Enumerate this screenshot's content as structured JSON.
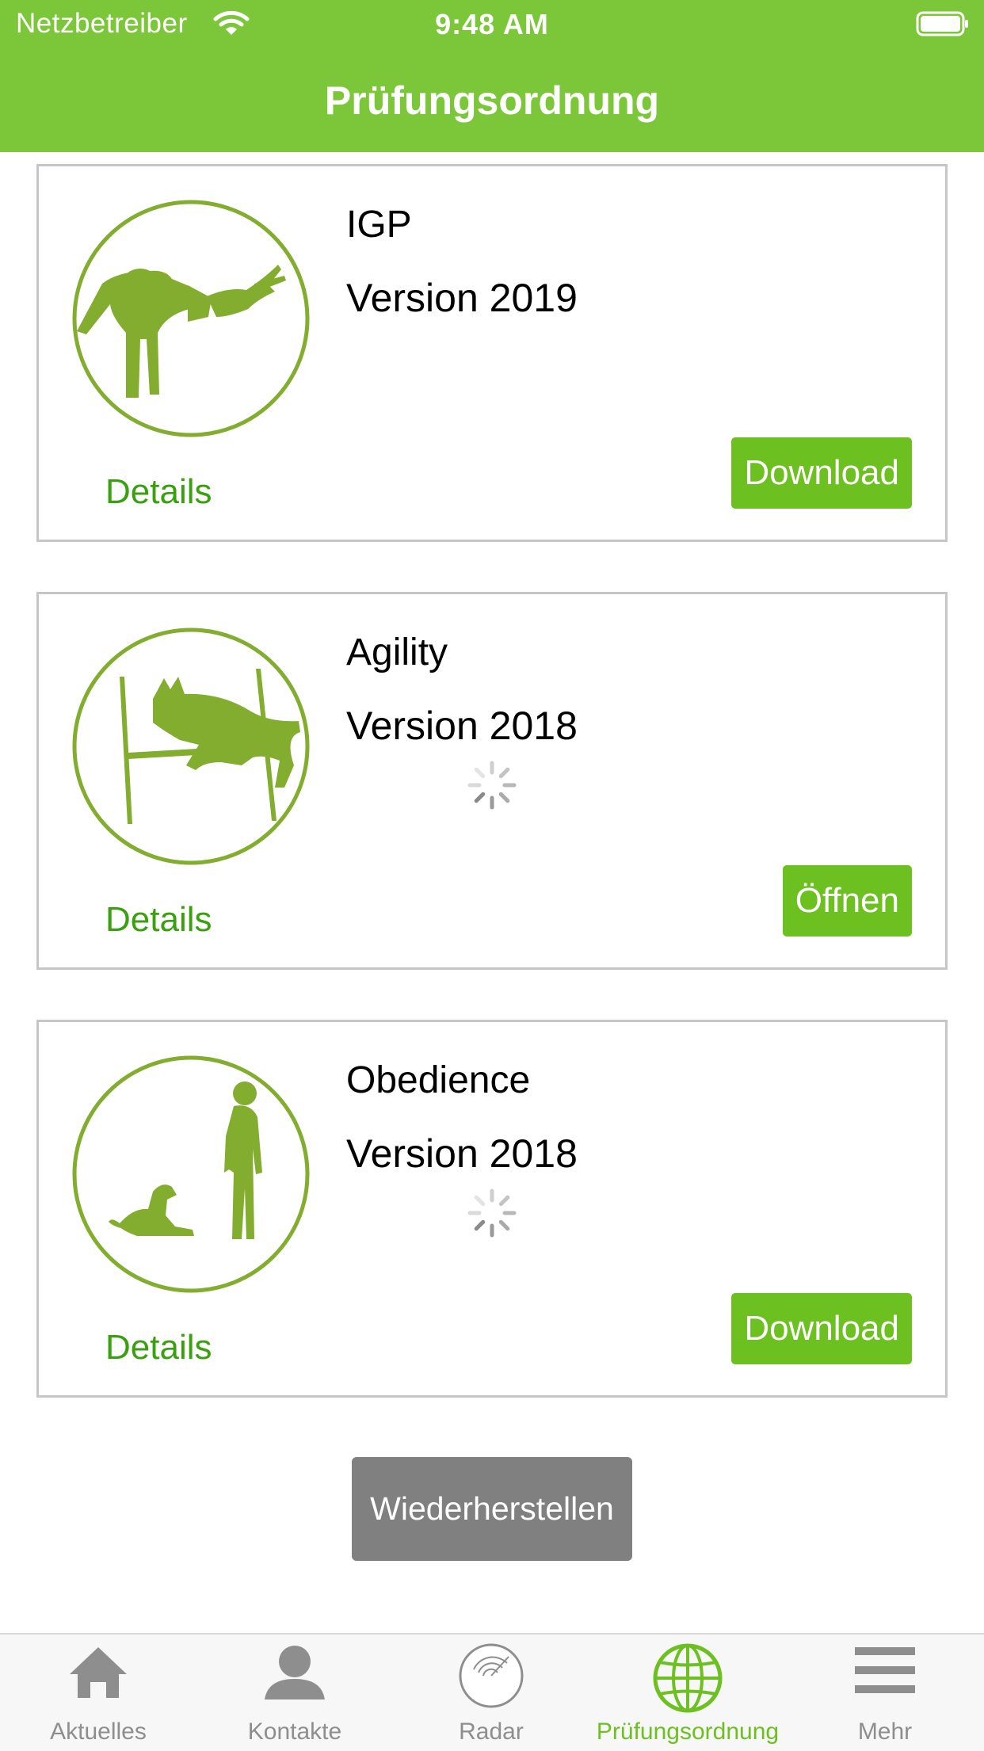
{
  "status_bar": {
    "carrier": "Netzbetreiber",
    "time": "9:48 AM"
  },
  "nav": {
    "title": "Prüfungsordnung"
  },
  "cards": [
    {
      "title": "IGP",
      "version": "Version 2019",
      "details_label": "Details",
      "action_label": "Download",
      "icon": "igp-bitework-icon",
      "loading": false
    },
    {
      "title": "Agility",
      "version": "Version 2018",
      "details_label": "Details",
      "action_label": "Öffnen",
      "icon": "agility-jump-icon",
      "loading": true
    },
    {
      "title": "Obedience",
      "version": "Version 2018",
      "details_label": "Details",
      "action_label": "Download",
      "icon": "obedience-icon",
      "loading": true
    }
  ],
  "restore_label": "Wiederherstellen",
  "tabs": [
    {
      "label": "Aktuelles",
      "icon": "home-icon",
      "active": false
    },
    {
      "label": "Kontakte",
      "icon": "person-icon",
      "active": false
    },
    {
      "label": "Radar",
      "icon": "radar-icon",
      "active": false
    },
    {
      "label": "Prüfungsordnung",
      "icon": "globe-icon",
      "active": true
    },
    {
      "label": "Mehr",
      "icon": "menu-icon",
      "active": false
    }
  ],
  "colors": {
    "brand_green": "#7cc63a",
    "button_green": "#6cc121",
    "link_green": "#3aa010",
    "icon_green": "#82ad2f",
    "restore_gray": "#808080"
  }
}
